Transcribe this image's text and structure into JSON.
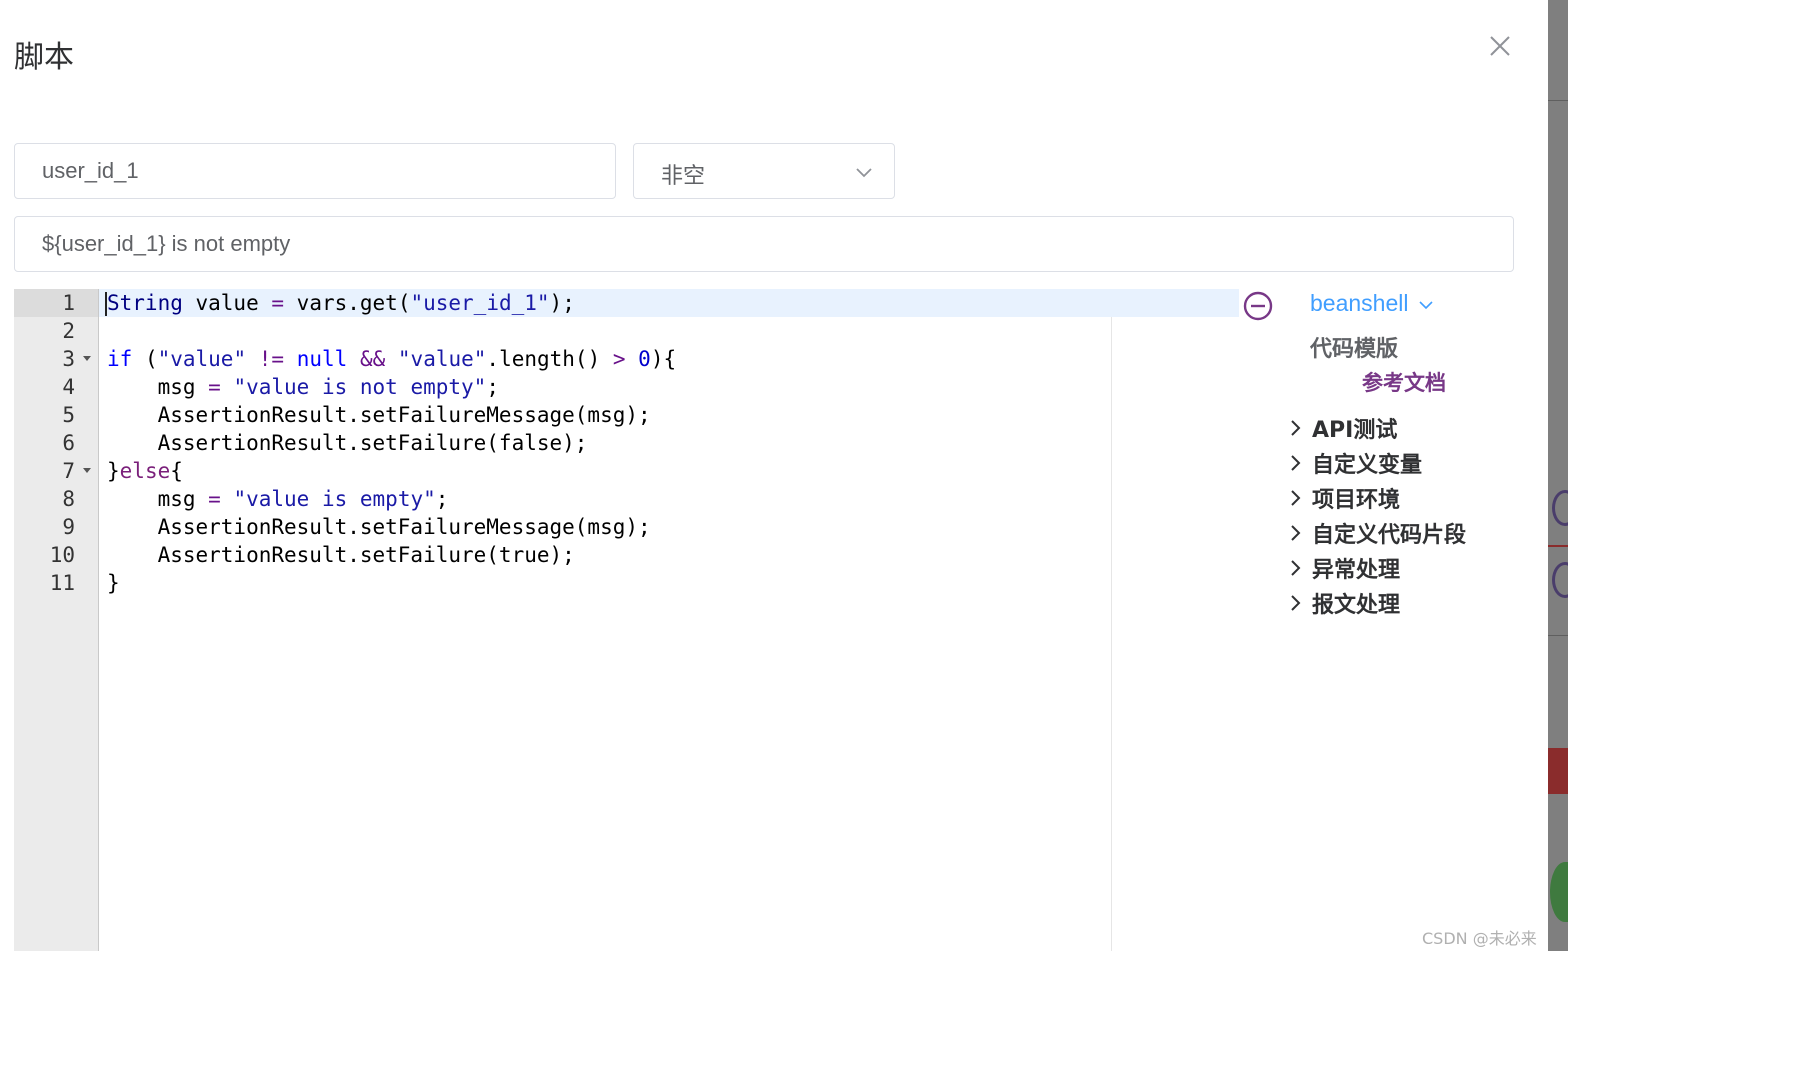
{
  "dialog": {
    "title": "脚本",
    "close_icon": "close-icon"
  },
  "form": {
    "variable_value": "user_id_1",
    "condition_value": "非空",
    "description_value": "${user_id_1} is not empty"
  },
  "editor": {
    "line_numbers": [
      "1",
      "2",
      "3",
      "4",
      "5",
      "6",
      "7",
      "8",
      "9",
      "10",
      "11"
    ],
    "lines": [
      "String value = vars.get(\"user_id_1\");",
      "",
      "if (\"value\" != null && \"value\".length() > 0){",
      "    msg = \"value is not empty\";",
      "    AssertionResult.setFailureMessage(msg);",
      "    AssertionResult.setFailure(false);",
      "}else{",
      "    msg = \"value is empty\";",
      "    AssertionResult.setFailureMessage(msg);",
      "    AssertionResult.setFailure(true);",
      "}"
    ]
  },
  "panel": {
    "language": "beanshell",
    "template_title": "代码模版",
    "docs_link": "参考文档",
    "tree": [
      "API测试",
      "自定义变量",
      "项目环境",
      "自定义代码片段",
      "异常处理",
      "报文处理"
    ]
  },
  "watermark": "CSDN @未必来迟",
  "colors": {
    "accent": "#409eff",
    "purple": "#783887",
    "border": "#dcdfe6"
  }
}
